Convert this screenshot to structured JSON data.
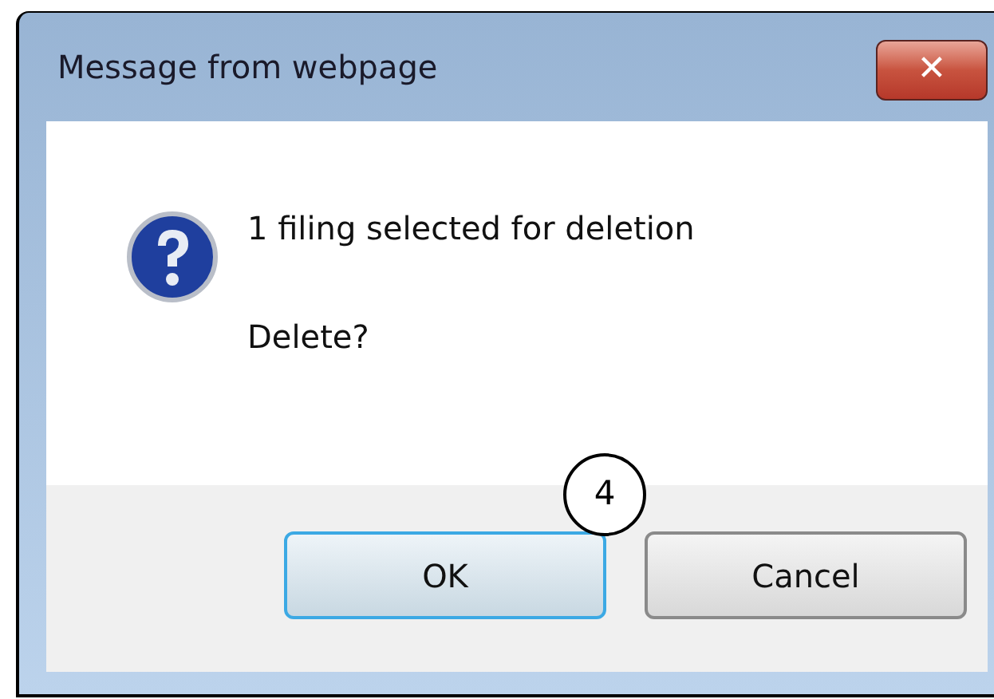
{
  "window": {
    "title": "Message from webpage",
    "close_label": "✕"
  },
  "message": {
    "text": "1 filing selected for deletion",
    "question": "Delete?"
  },
  "buttons": [
    {
      "label": "OK",
      "selected": true
    },
    {
      "label": "Cancel",
      "selected": false
    }
  ],
  "callout": {
    "label": "4"
  }
}
